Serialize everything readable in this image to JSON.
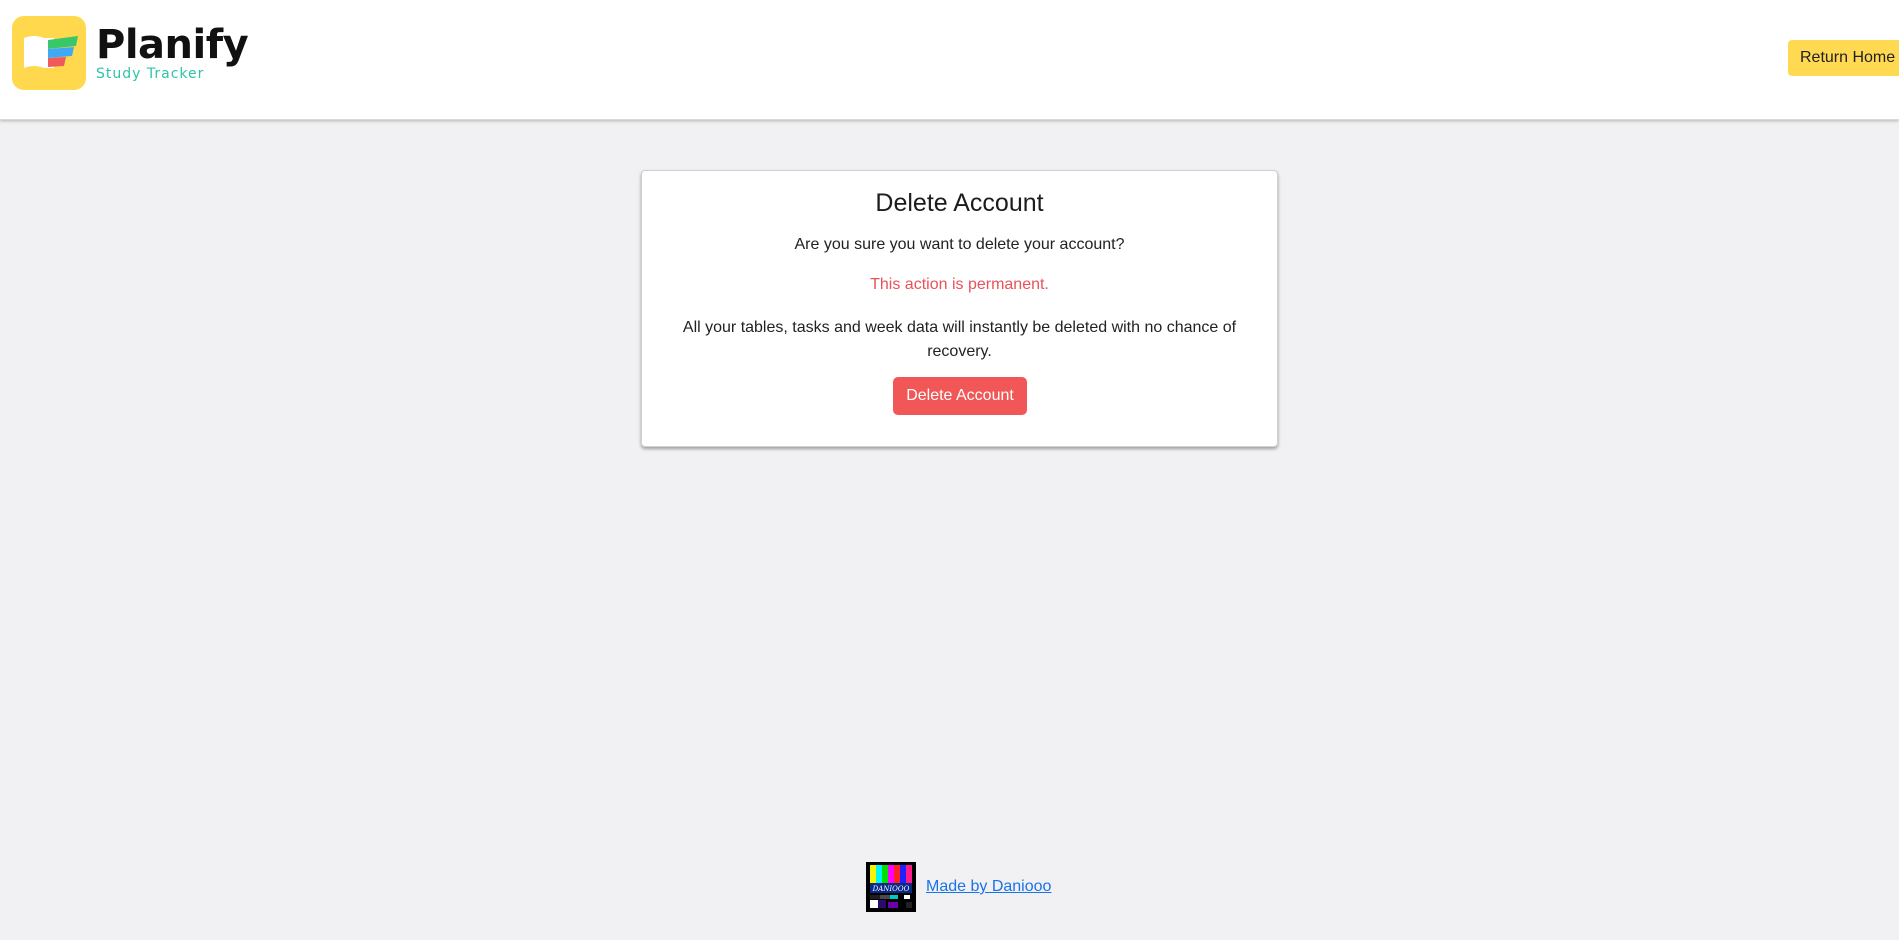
{
  "header": {
    "brand_name": "Planify",
    "brand_tagline": "Study Tracker",
    "return_home_label": "Return Home",
    "logo_icon": "open-book-icon"
  },
  "card": {
    "title": "Delete Account",
    "question": "Are you sure you want to delete your account?",
    "warning": "This action is permanent.",
    "detail": "All your tables, tasks and week data will instantly be deleted with no chance of recovery.",
    "delete_button_label": "Delete Account"
  },
  "footer": {
    "credit_link": "Made by Daniooo",
    "author_logo_icon": "test-pattern-icon"
  },
  "colors": {
    "accent_yellow": "#ffd951",
    "danger": "#f25757",
    "warning_text": "#e8525a",
    "brand_teal": "#2ec4a5",
    "link": "#1a73e8",
    "page_background": "#f1f1f3"
  }
}
